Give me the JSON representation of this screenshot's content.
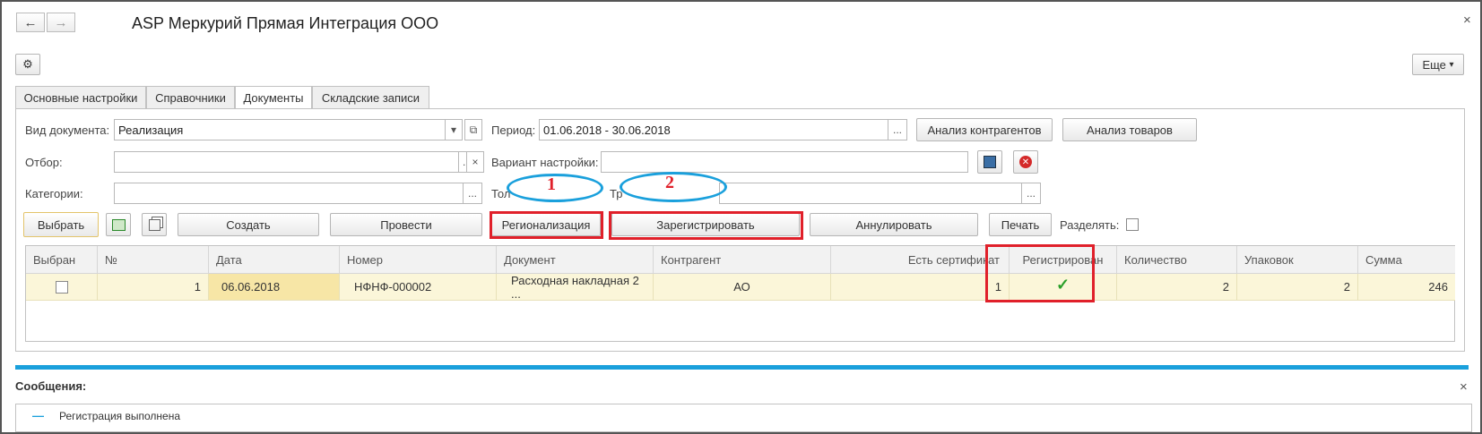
{
  "window": {
    "title": "ASP Меркурий Прямая Интеграция ООО",
    "back_icon": "←",
    "forward_icon": "→",
    "close_icon": "×"
  },
  "toolbar": {
    "settings_icon": "⚙",
    "more_label": "Еще",
    "more_arrow": "▾"
  },
  "tabs": [
    {
      "label": "Основные настройки"
    },
    {
      "label": "Справочники"
    },
    {
      "label": "Документы"
    },
    {
      "label": "Складские записи"
    }
  ],
  "form": {
    "doc_type_label": "Вид документа:",
    "doc_type_value": "Реализация",
    "period_label": "Период:",
    "period_value": "01.06.2018 - 30.06.2018",
    "filter_label": "Отбор:",
    "filter_value": "",
    "variant_label": "Вариант настройки:",
    "variant_value": "",
    "categories_label": "Категории:",
    "categories_value": "",
    "only_label_fragment": "Тол",
    "tr_label_fragment": "Тр",
    "ellipsis": "...",
    "clear_icon": "×",
    "dropdown_icon": "▾",
    "open_icon": "⧉"
  },
  "buttons": {
    "analyze_counterparties": "Анализ контрагентов",
    "analyze_goods": "Анализ товаров",
    "select": "Выбрать",
    "create": "Создать",
    "post": "Провести",
    "regionalization": "Регионализация",
    "register": "Зарегистрировать",
    "cancel": "Аннулировать",
    "print": "Печать",
    "split_label": "Разделять:"
  },
  "annotations": {
    "one": "1",
    "two": "2"
  },
  "table": {
    "headers": [
      "Выбран",
      "№",
      "Дата",
      "Номер",
      "Документ",
      "Контрагент",
      "Есть сертификат",
      "Регистрирован",
      "Количество",
      "Упаковок",
      "Сумма"
    ],
    "rows": [
      {
        "num": "1",
        "date": "06.06.2018",
        "number": "НФНФ-000002",
        "document": "Расходная накладная 2 ...",
        "counterparty": "АО",
        "has_certificate": "1",
        "registered_icon": "✓",
        "quantity": "2",
        "packages": "2",
        "sum": "246"
      }
    ]
  },
  "messages": {
    "title": "Сообщения:",
    "close_icon": "×",
    "items": [
      {
        "marker": "—",
        "text": "Регистрация выполнена"
      }
    ]
  },
  "colors": {
    "accent_blue": "#1aa0dc",
    "annotation_red": "#e0202a",
    "row_highlight": "#fbf6d9",
    "check_green": "#2aa02a"
  }
}
